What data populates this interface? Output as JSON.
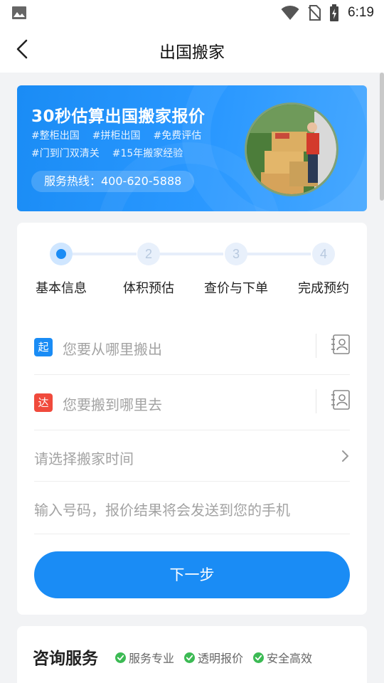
{
  "status_bar": {
    "time": "6:19"
  },
  "nav": {
    "title": "出国搬家"
  },
  "banner": {
    "headline": "30秒估算出国搬家报价",
    "tags_row1": [
      "#整柜出国",
      "#拼柜出国",
      "#免费评估"
    ],
    "tags_row2": [
      "#门到门双清关",
      "#15年搬家经验"
    ],
    "hotline": "服务热线：400-620-5888"
  },
  "steps": [
    {
      "number": "1",
      "label": "基本信息",
      "active": true
    },
    {
      "number": "2",
      "label": "体积预估",
      "active": false
    },
    {
      "number": "3",
      "label": "查价与下单",
      "active": false
    },
    {
      "number": "4",
      "label": "完成预约",
      "active": false
    }
  ],
  "form": {
    "origin": {
      "badge": "起",
      "placeholder": "您要从哪里搬出"
    },
    "destination": {
      "badge": "达",
      "placeholder": "您要搬到哪里去"
    },
    "time": {
      "placeholder": "请选择搬家时间"
    },
    "phone": {
      "placeholder": "输入号码，报价结果将会发送到您的手机"
    },
    "next_label": "下一步"
  },
  "consult": {
    "title": "咨询服务",
    "features": [
      "服务专业",
      "透明报价",
      "安全高效"
    ]
  },
  "colors": {
    "accent": "#1a8cf5",
    "start_badge": "#1a8cf5",
    "end_badge": "#f04a3c",
    "check": "#3cba54"
  },
  "icons": {
    "status_left": "gallery-icon",
    "status_right": [
      "wifi-icon",
      "no-sim-icon",
      "battery-charging-icon"
    ],
    "nav_back": "back-arrow-icon",
    "contact": "contact-book-icon",
    "chevron": "chevron-right-icon",
    "check": "check-circle-icon"
  }
}
